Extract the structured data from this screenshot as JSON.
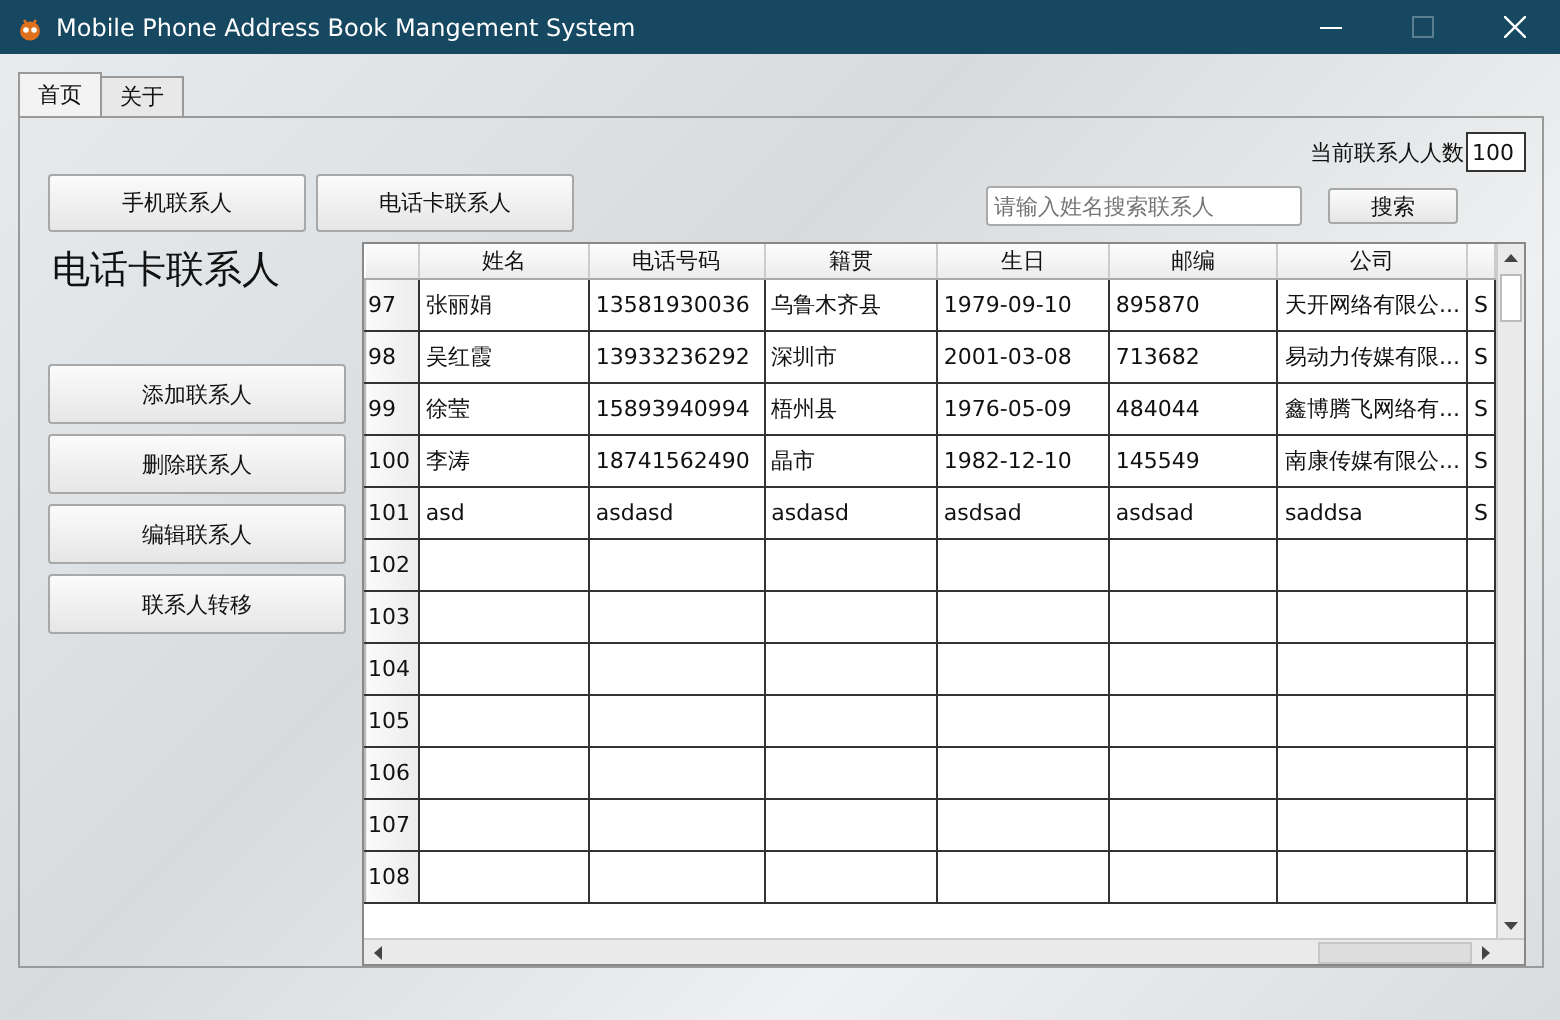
{
  "window": {
    "title": "Mobile Phone Address Book Mangement System",
    "maximize_disabled": true
  },
  "tabs": [
    {
      "label": "首页",
      "selected": true
    },
    {
      "label": "关于",
      "selected": false
    }
  ],
  "top_buttons": [
    "手机联系人",
    "电话卡联系人"
  ],
  "count": {
    "label": "当前联系人人数",
    "value": "100"
  },
  "search": {
    "placeholder": "请输入姓名搜索联系人",
    "button": "搜索"
  },
  "section_title": "电话卡联系人",
  "side_buttons": [
    "添加联系人",
    "删除联系人",
    "编辑联系人",
    "联系人转移"
  ],
  "table": {
    "columns": [
      "姓名",
      "电话号码",
      "籍贯",
      "生日",
      "邮编",
      "公司"
    ],
    "rows": [
      {
        "number": "97",
        "cells": [
          "张丽娟",
          "13581930036",
          "乌鲁木齐县",
          "1979-09-10",
          "895870",
          "天开网络有限公...",
          "S"
        ]
      },
      {
        "number": "98",
        "cells": [
          "吴红霞",
          "13933236292",
          "深圳市",
          "2001-03-08",
          "713682",
          "易动力传媒有限...",
          "S"
        ]
      },
      {
        "number": "99",
        "cells": [
          "徐莹",
          "15893940994",
          "梧州县",
          "1976-05-09",
          "484044",
          "鑫博腾飞网络有...",
          "S"
        ]
      },
      {
        "number": "100",
        "cells": [
          "李涛",
          "18741562490",
          "晶市",
          "1982-12-10",
          "145549",
          "南康传媒有限公...",
          "S"
        ]
      },
      {
        "number": "101",
        "cells": [
          "asd",
          "asdasd",
          "asdasd",
          "asdsad",
          "asdsad",
          "saddsa",
          "S"
        ]
      },
      {
        "number": "102"
      },
      {
        "number": "103"
      },
      {
        "number": "104"
      },
      {
        "number": "105"
      },
      {
        "number": "106"
      },
      {
        "number": "107"
      },
      {
        "number": "108"
      }
    ]
  }
}
